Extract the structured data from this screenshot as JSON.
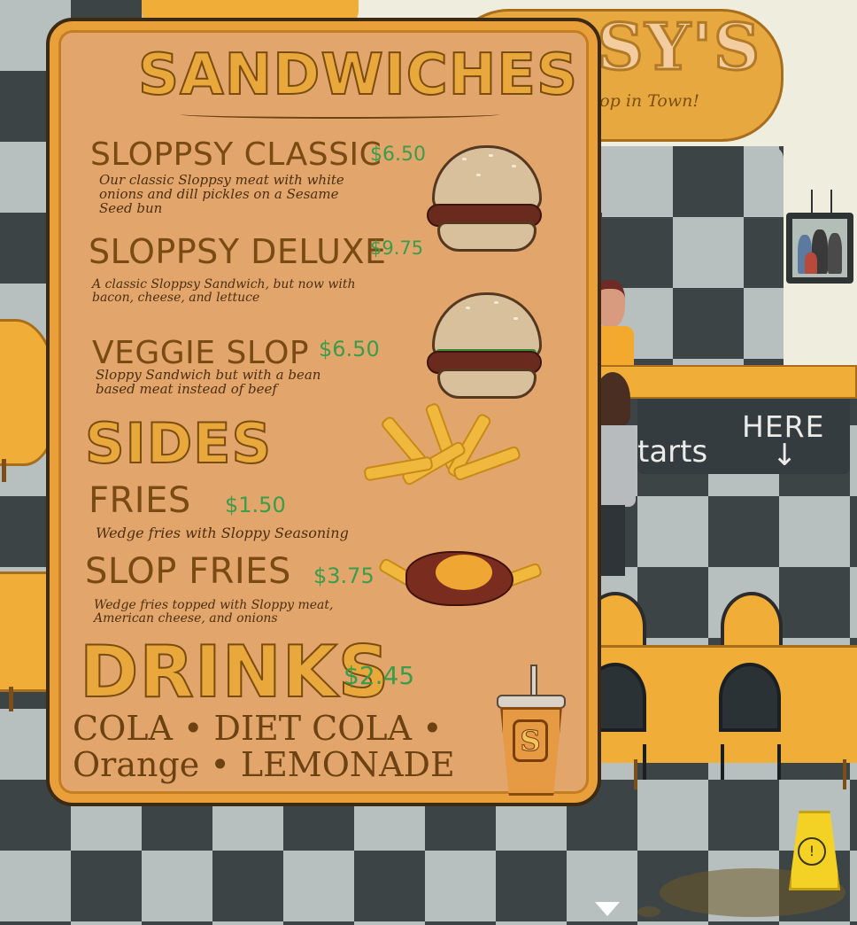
{
  "restaurant": {
    "logo_text": "PPSY'S",
    "tagline": "op in Town!"
  },
  "queue_sign": {
    "here": "HERE",
    "starts": "tarts",
    "arrow": "↓"
  },
  "menu": {
    "sections": {
      "sandwiches": "SANDWICHES",
      "sides": "SIDES",
      "drinks": "DRINKS"
    },
    "sandwiches": [
      {
        "name": "SLOPPSY CLASSIC",
        "price": "$6.50",
        "description": "Our classic Sloppsy meat with white onions and dill pickles on a Sesame Seed bun"
      },
      {
        "name": "SLOPPSY DELUXE",
        "price": "$9.75",
        "description": "A classic Sloppsy Sandwich, but now with bacon, cheese, and lettuce"
      },
      {
        "name": "VEGGIE SLOP",
        "price": "$6.50",
        "description": "Sloppy Sandwich but with a bean based meat instead of beef"
      }
    ],
    "sides": [
      {
        "name": "FRIES",
        "price": "$1.50",
        "description": "Wedge fries with Sloppy Seasoning"
      },
      {
        "name": "SLOP FRIES",
        "price": "$3.75",
        "description": "Wedge fries topped with Sloppy meat, American cheese, and onions"
      }
    ],
    "drinks": {
      "price": "$2.45",
      "items": "COLA • DIET COLA • Orange • LEMONADE"
    }
  },
  "icons": {
    "burger": "burger-icon",
    "fries": "fries-icon",
    "slop_fries": "slop-fries-icon",
    "drink_cup": "drink-cup-icon",
    "wet_floor": "wet-floor-sign-icon",
    "scroll_down": "chevron-down-icon"
  },
  "colors": {
    "menu_bg": "#e2a66c",
    "heading": "#e9a83c",
    "price": "#3b9c4b",
    "item_name": "#7a4a14"
  }
}
